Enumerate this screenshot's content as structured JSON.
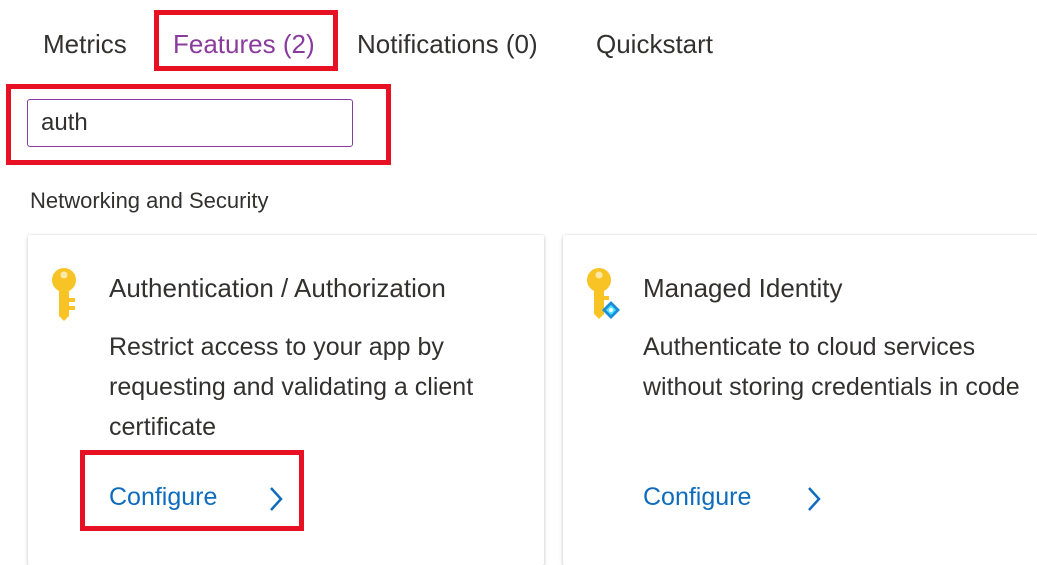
{
  "tabs": [
    {
      "label": "Metrics"
    },
    {
      "label": "Features (2)",
      "active": true
    },
    {
      "label": "Notifications (0)"
    },
    {
      "label": "Quickstart"
    }
  ],
  "search": {
    "value": "auth"
  },
  "section": {
    "title": "Networking and Security"
  },
  "cards": [
    {
      "icon": "key-icon",
      "title": "Authentication / Authorization",
      "description": "Restrict access to your app by requesting and validating a client certificate",
      "action": "Configure"
    },
    {
      "icon": "managed-identity-icon",
      "title": "Managed Identity",
      "description": "Authenticate to cloud services without storing credentials in code",
      "action": "Configure"
    }
  ],
  "colors": {
    "accent": "#8a3b9e",
    "link": "#0f6cbd",
    "highlight": "#e81123",
    "key": "#f7c325"
  }
}
